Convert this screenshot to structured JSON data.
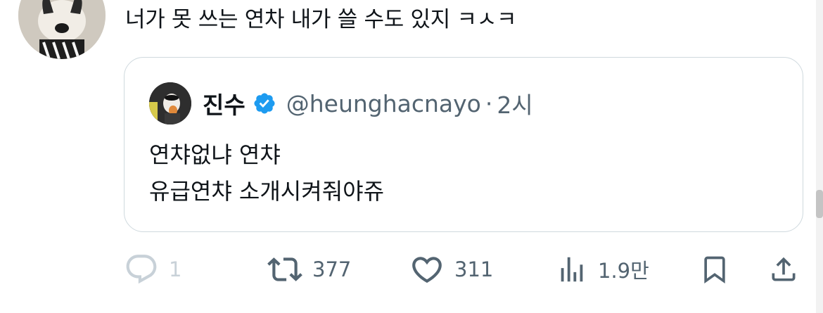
{
  "tweet": {
    "text": "너가 못 쓰는 연차 내가 쓸 수도 있지 ㅋㅅㅋ",
    "avatar_icon": "dog-avatar"
  },
  "quote": {
    "name": "진수",
    "handle": "@heunghacnayo",
    "separator": "·",
    "time": "2시",
    "verified_icon": "verified-badge-icon",
    "verified_color": "#1d9bf0",
    "body_line1": "연챠없냐 연챠",
    "body_line2": "유급연챠 소개시켜줘야쥬"
  },
  "actions": {
    "reply_count": "1",
    "retweet_count": "377",
    "like_count": "311",
    "views_count": "1.9만"
  },
  "colors": {
    "text": "#0f1419",
    "muted": "#536471",
    "border": "#cfd9de",
    "reply_disabled": "#c8d1d8"
  }
}
